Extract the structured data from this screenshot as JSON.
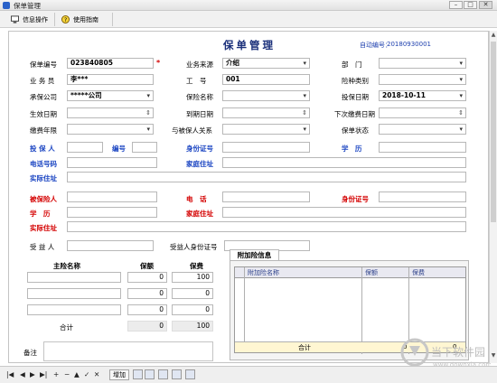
{
  "window": {
    "title": "保单管理",
    "buttons": {
      "minimize": "–",
      "maximize": "□",
      "close": "✕"
    }
  },
  "toolbar": {
    "items": [
      {
        "label": "信息操作",
        "icon": "monitor-icon"
      },
      {
        "label": "使用指南",
        "icon": "question-icon"
      }
    ]
  },
  "form": {
    "title": "保单管理",
    "auto_no_label": "自动编号：",
    "auto_no_value": "20180930001",
    "required_mark": "*",
    "fields": {
      "policy_no": {
        "label": "保单编号",
        "value": "023840805"
      },
      "business_source": {
        "label": "业务来源",
        "value": "介绍"
      },
      "department": {
        "label": "部　门",
        "value": ""
      },
      "agent": {
        "label": "业 务 员",
        "value": "李***"
      },
      "employee_no": {
        "label": "工　号",
        "value": "001"
      },
      "insurance_type": {
        "label": "险种类别",
        "value": ""
      },
      "insurer": {
        "label": "承保公司",
        "value": "*****公司"
      },
      "insurance_name": {
        "label": "保险名称",
        "value": ""
      },
      "insure_date": {
        "label": "投保日期",
        "value": "2018-10-11"
      },
      "effective_date": {
        "label": "生效日期",
        "value": ""
      },
      "expiry_date": {
        "label": "到期日期",
        "value": ""
      },
      "next_payment_date": {
        "label": "下次缴费日期",
        "value": ""
      },
      "payment_years": {
        "label": "缴费年限",
        "value": ""
      },
      "relation": {
        "label": "与被保人关系",
        "value": ""
      },
      "policy_status": {
        "label": "保单状态",
        "value": ""
      }
    },
    "policyholder": {
      "name_label": "投 保 人",
      "no_label": "编号",
      "id_label": "身份证号",
      "edu_label": "学　历",
      "phone_label": "电话号码",
      "home_address_label": "家庭住址",
      "address_label": "实际住址"
    },
    "insured": {
      "name_label": "被保险人",
      "phone_label": "电　话",
      "id_label": "身份证号",
      "edu_label": "学　历",
      "home_address_label": "家庭住址",
      "address_label": "实际住址"
    },
    "beneficiary": {
      "name_label": "受 益 人",
      "id_label": "受益人身份证号"
    },
    "main_insurance": {
      "headers": [
        "主险名称",
        "保额",
        "保费"
      ],
      "rows": [
        {
          "name": "",
          "amount": "0",
          "premium": "100"
        },
        {
          "name": "",
          "amount": "0",
          "premium": "0"
        },
        {
          "name": "",
          "amount": "0",
          "premium": "0"
        }
      ],
      "total_label": "合计",
      "total_amount": "0",
      "total_premium": "100"
    },
    "additional_insurance": {
      "tab_label": "附加险信息",
      "headers": [
        "附加险名称",
        "保额",
        "保费"
      ],
      "total_label": "合计",
      "total_amount": "0",
      "total_premium": "0"
    },
    "remark_label": "备注"
  },
  "navigator": {
    "buttons": [
      "|◀",
      "◀",
      "▶",
      "▶|",
      "+",
      "−",
      "▲",
      "✓",
      "✕",
      "↻"
    ],
    "add_label": "增加"
  },
  "watermark": {
    "text": "当下软件园",
    "subtext": "www.downxia.com"
  },
  "colors": {
    "title": "#1a2f7a",
    "red_label": "#d40000",
    "blue_label": "#1a44c2",
    "highlight_row": "#fff6d2"
  }
}
